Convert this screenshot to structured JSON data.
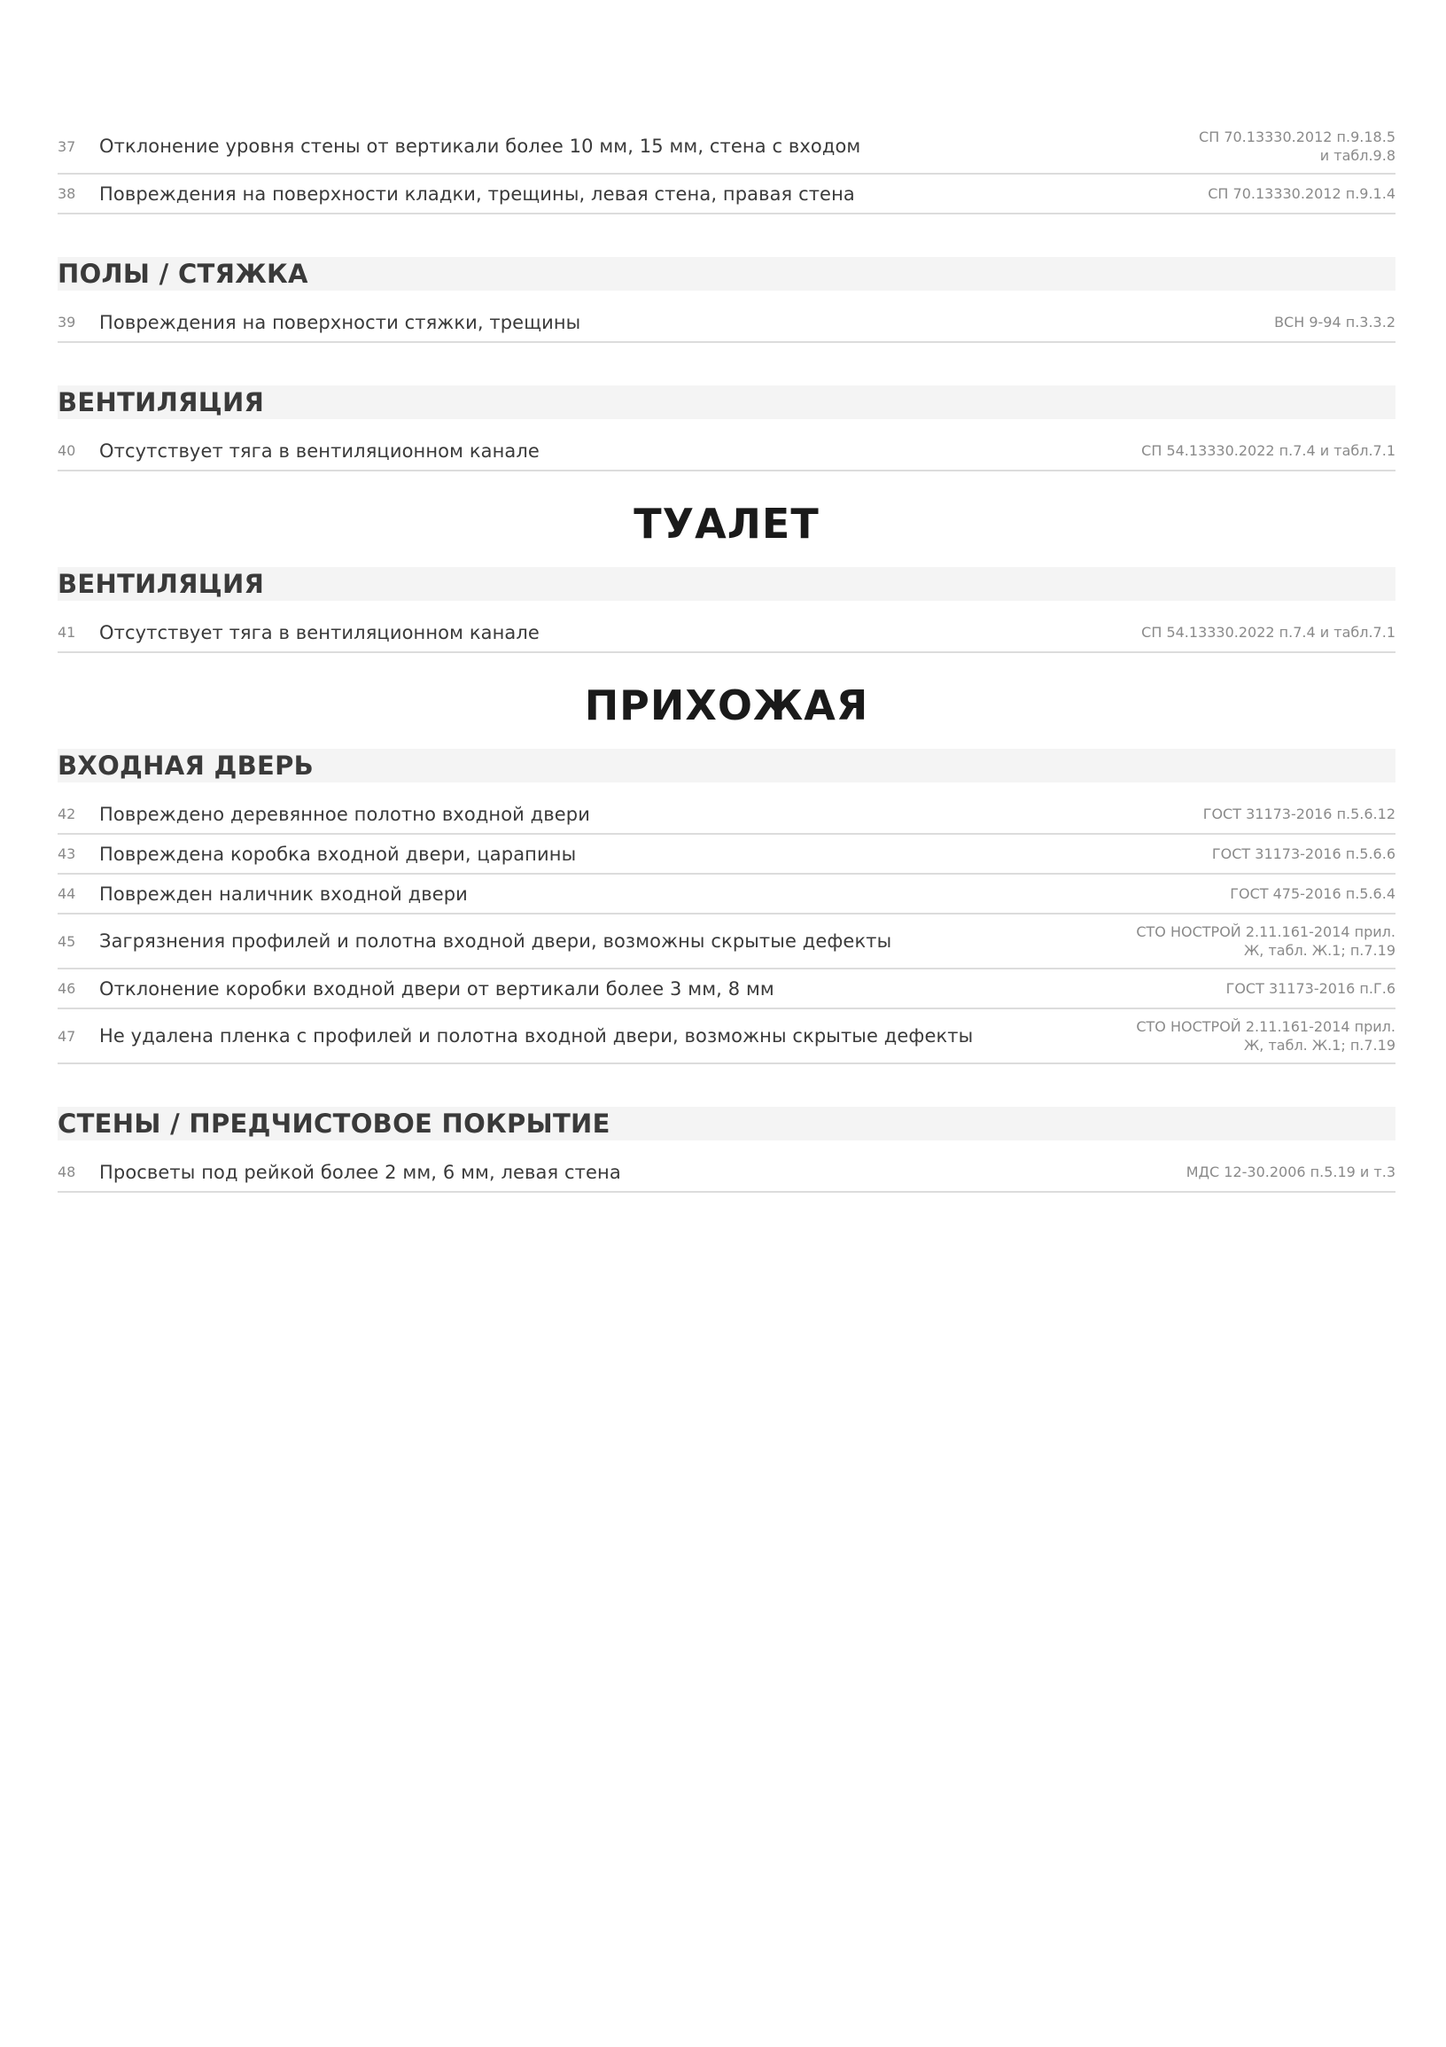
{
  "blocks": {
    "b0": {
      "rows": [
        {
          "num": "37",
          "desc": "Отклонение уровня стены от вертикали более 10 мм, 15 мм, стена с входом",
          "ref": "СП 70.13330.2012 п.9.18.5 и табл.9.8"
        },
        {
          "num": "38",
          "desc": "Повреждения на поверхности кладки, трещины, левая стена, правая стена",
          "ref": "СП 70.13330.2012 п.9.1.4"
        }
      ]
    },
    "b1": {
      "section": "ПОЛЫ / СТЯЖКА",
      "rows": [
        {
          "num": "39",
          "desc": "Повреждения на поверхности стяжки, трещины",
          "ref": "ВСН 9-94 п.3.3.2"
        }
      ]
    },
    "b2": {
      "section": "ВЕНТИЛЯЦИЯ",
      "rows": [
        {
          "num": "40",
          "desc": "Отсутствует тяга в вентиляционном канале",
          "ref": "СП 54.13330.2022 п.7.4 и табл.7.1"
        }
      ]
    },
    "b3": {
      "room": "ТУАЛЕТ",
      "section": "ВЕНТИЛЯЦИЯ",
      "rows": [
        {
          "num": "41",
          "desc": "Отсутствует тяга в вентиляционном канале",
          "ref": "СП 54.13330.2022 п.7.4 и табл.7.1"
        }
      ]
    },
    "b4": {
      "room": "ПРИХОЖАЯ",
      "section": "ВХОДНАЯ ДВЕРЬ",
      "rows": [
        {
          "num": "42",
          "desc": "Повреждено деревянное полотно входной двери",
          "ref": "ГОСТ 31173-2016 п.5.6.12"
        },
        {
          "num": "43",
          "desc": "Повреждена коробка входной двери, царапины",
          "ref": "ГОСТ 31173-2016 п.5.6.6"
        },
        {
          "num": "44",
          "desc": "Поврежден наличник входной двери",
          "ref": "ГОСТ 475-2016 п.5.6.4"
        },
        {
          "num": "45",
          "desc": "Загрязнения профилей и полотна входной двери, возможны скрытые дефекты",
          "ref": "СТО НОСТРОЙ 2.11.161-2014 прил. Ж, табл. Ж.1; п.7.19"
        },
        {
          "num": "46",
          "desc": "Отклонение коробки входной двери от вертикали более 3 мм, 8 мм",
          "ref": "ГОСТ 31173-2016 п.Г.6"
        },
        {
          "num": "47",
          "desc": "Не удалена пленка с профилей и полотна входной двери, возможны скрытые дефекты",
          "ref": "СТО НОСТРОЙ 2.11.161-2014 прил. Ж, табл. Ж.1; п.7.19"
        }
      ]
    },
    "b5": {
      "section": "СТЕНЫ / ПРЕДЧИСТОВОЕ ПОКРЫТИЕ",
      "rows": [
        {
          "num": "48",
          "desc": "Просветы под рейкой более 2 мм, 6 мм, левая стена",
          "ref": "МДС 12-30.2006 п.5.19 и т.3"
        }
      ]
    }
  }
}
